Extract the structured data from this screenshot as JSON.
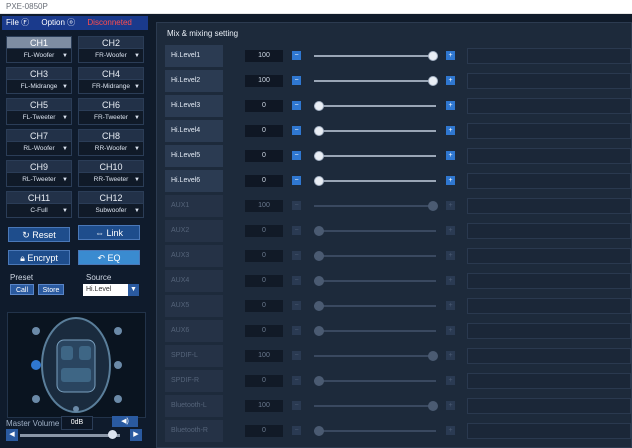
{
  "window": {
    "title": "PXE-0850P"
  },
  "menu": {
    "file": "File Ⓕ",
    "option": "Option ⓞ",
    "status": "Disconneted"
  },
  "channels": [
    {
      "name": "CH1",
      "assign": "FL-Woofer",
      "active": true
    },
    {
      "name": "CH2",
      "assign": "FR-Woofer",
      "active": false
    },
    {
      "name": "CH3",
      "assign": "FL-Midrange",
      "active": false
    },
    {
      "name": "CH4",
      "assign": "FR-Midrange",
      "active": false
    },
    {
      "name": "CH5",
      "assign": "FL-Tweeter",
      "active": false
    },
    {
      "name": "CH6",
      "assign": "FR-Tweeter",
      "active": false
    },
    {
      "name": "CH7",
      "assign": "RL-Woofer",
      "active": false
    },
    {
      "name": "CH8",
      "assign": "RR-Woofer",
      "active": false
    },
    {
      "name": "CH9",
      "assign": "RL-Tweeter",
      "active": false
    },
    {
      "name": "CH10",
      "assign": "RR-Tweeter",
      "active": false
    },
    {
      "name": "CH11",
      "assign": "C-Full",
      "active": false
    },
    {
      "name": "CH12",
      "assign": "Subwoofer",
      "active": false
    }
  ],
  "buttons": {
    "reset": "Reset",
    "link": "Link",
    "encrypt": "Encrypt",
    "eq": "EQ"
  },
  "preset": {
    "label": "Preset",
    "call": "Call",
    "store": "Store"
  },
  "source": {
    "label": "Source",
    "value": "Hi.Level"
  },
  "master_volume": {
    "label": "Master Volume",
    "value": "0dB"
  },
  "mixing": {
    "title": "Mix & mixing setting",
    "rows": [
      {
        "label": "Hi.Level1",
        "value": "100",
        "level": 1.0,
        "enabled": true
      },
      {
        "label": "Hi.Level2",
        "value": "100",
        "level": 1.0,
        "enabled": true
      },
      {
        "label": "Hi.Level3",
        "value": "0",
        "level": 0.0,
        "enabled": true
      },
      {
        "label": "Hi.Level4",
        "value": "0",
        "level": 0.0,
        "enabled": true
      },
      {
        "label": "Hi.Level5",
        "value": "0",
        "level": 0.0,
        "enabled": true
      },
      {
        "label": "Hi.Level6",
        "value": "0",
        "level": 0.0,
        "enabled": true
      },
      {
        "label": "AUX1",
        "value": "100",
        "level": 1.0,
        "enabled": false
      },
      {
        "label": "AUX2",
        "value": "0",
        "level": 0.0,
        "enabled": false
      },
      {
        "label": "AUX3",
        "value": "0",
        "level": 0.0,
        "enabled": false
      },
      {
        "label": "AUX4",
        "value": "0",
        "level": 0.0,
        "enabled": false
      },
      {
        "label": "AUX5",
        "value": "0",
        "level": 0.0,
        "enabled": false
      },
      {
        "label": "AUX6",
        "value": "0",
        "level": 0.0,
        "enabled": false
      },
      {
        "label": "SPDIF-L",
        "value": "100",
        "level": 1.0,
        "enabled": false
      },
      {
        "label": "SPDIF-R",
        "value": "0",
        "level": 0.0,
        "enabled": false
      },
      {
        "label": "Bluetooth-L",
        "value": "100",
        "level": 1.0,
        "enabled": false
      },
      {
        "label": "Bluetooth-R",
        "value": "0",
        "level": 0.0,
        "enabled": false
      }
    ]
  },
  "icons": {
    "reset": "reset-icon",
    "link": "link-icon",
    "encrypt": "lock-icon",
    "eq": "back-arrow-icon",
    "source_dropdown": "chevron-down-icon",
    "mute": "speaker-icon"
  },
  "colors": {
    "accent": "#2f77d0",
    "panel": "#1d2a3b",
    "status_error": "#ff4d4d"
  }
}
